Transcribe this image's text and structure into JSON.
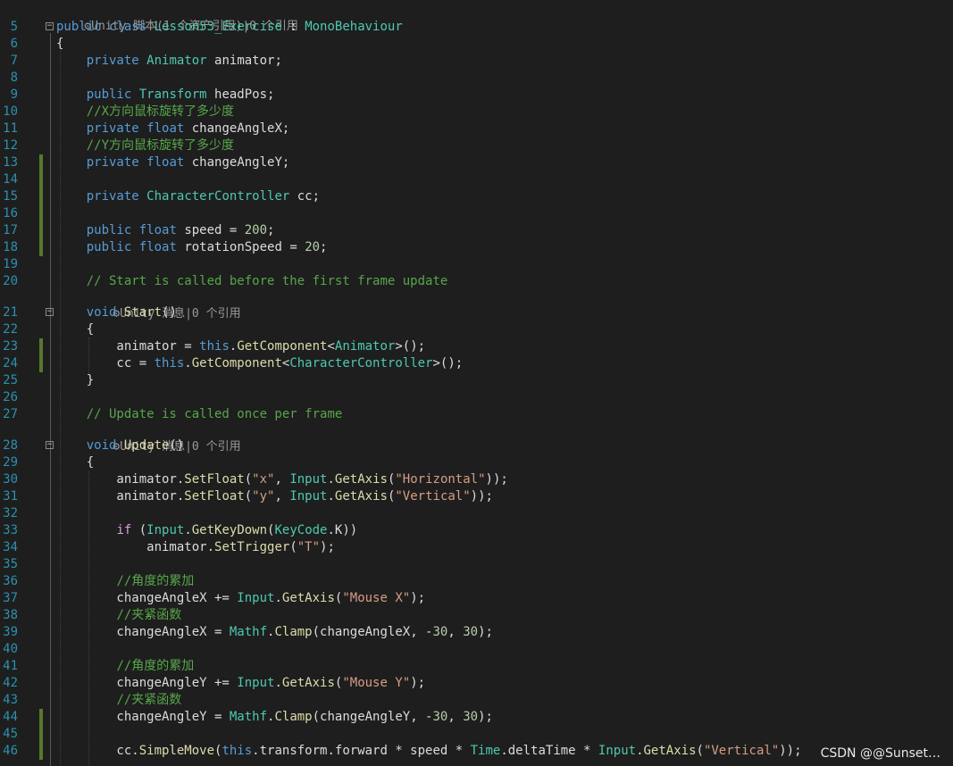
{
  "editor": {
    "codelens": {
      "class_refs": "Unity 脚本(1 个资产引用)|0 个引用",
      "start_refs": "Unity 消息|0 个引用",
      "update_refs": "Unity 消息|0 个引用"
    },
    "lines": [
      {
        "n": "5",
        "fold": "minus",
        "changed": false,
        "tokens": [
          {
            "t": "public",
            "c": "kw"
          },
          {
            "t": " "
          },
          {
            "t": "class",
            "c": "kw"
          },
          {
            "t": " "
          },
          {
            "t": "Lesson53_Exercise",
            "c": "ty"
          },
          {
            "t": " : "
          },
          {
            "t": "MonoBehaviour",
            "c": "ty"
          }
        ]
      },
      {
        "n": "6",
        "fold": "",
        "changed": false,
        "tokens": [
          {
            "t": "{"
          }
        ]
      },
      {
        "n": "7",
        "fold": "",
        "changed": false,
        "tokens": [
          {
            "t": "    "
          },
          {
            "t": "private",
            "c": "kw"
          },
          {
            "t": " "
          },
          {
            "t": "Animator",
            "c": "ty"
          },
          {
            "t": " animator;"
          }
        ]
      },
      {
        "n": "8",
        "fold": "",
        "changed": false,
        "tokens": []
      },
      {
        "n": "9",
        "fold": "",
        "changed": false,
        "tokens": [
          {
            "t": "    "
          },
          {
            "t": "public",
            "c": "kw"
          },
          {
            "t": " "
          },
          {
            "t": "Transform",
            "c": "ty"
          },
          {
            "t": " headPos;"
          }
        ]
      },
      {
        "n": "10",
        "fold": "",
        "changed": false,
        "tokens": [
          {
            "t": "    "
          },
          {
            "t": "//X方向鼠标旋转了多少度",
            "c": "cm"
          }
        ]
      },
      {
        "n": "11",
        "fold": "",
        "changed": false,
        "tokens": [
          {
            "t": "    "
          },
          {
            "t": "private",
            "c": "kw"
          },
          {
            "t": " "
          },
          {
            "t": "float",
            "c": "kw"
          },
          {
            "t": " changeAngleX;"
          }
        ]
      },
      {
        "n": "12",
        "fold": "",
        "changed": false,
        "tokens": [
          {
            "t": "    "
          },
          {
            "t": "//Y方向鼠标旋转了多少度",
            "c": "cm"
          }
        ]
      },
      {
        "n": "13",
        "fold": "",
        "changed": true,
        "tokens": [
          {
            "t": "    "
          },
          {
            "t": "private",
            "c": "kw"
          },
          {
            "t": " "
          },
          {
            "t": "float",
            "c": "kw"
          },
          {
            "t": " changeAngleY;"
          }
        ]
      },
      {
        "n": "14",
        "fold": "",
        "changed": true,
        "tokens": []
      },
      {
        "n": "15",
        "fold": "",
        "changed": true,
        "tokens": [
          {
            "t": "    "
          },
          {
            "t": "private",
            "c": "kw"
          },
          {
            "t": " "
          },
          {
            "t": "CharacterController",
            "c": "ty"
          },
          {
            "t": " cc;"
          }
        ]
      },
      {
        "n": "16",
        "fold": "",
        "changed": true,
        "tokens": []
      },
      {
        "n": "17",
        "fold": "",
        "changed": true,
        "tokens": [
          {
            "t": "    "
          },
          {
            "t": "public",
            "c": "kw"
          },
          {
            "t": " "
          },
          {
            "t": "float",
            "c": "kw"
          },
          {
            "t": " speed = "
          },
          {
            "t": "200",
            "c": "num"
          },
          {
            "t": ";"
          }
        ]
      },
      {
        "n": "18",
        "fold": "",
        "changed": true,
        "tokens": [
          {
            "t": "    "
          },
          {
            "t": "public",
            "c": "kw"
          },
          {
            "t": " "
          },
          {
            "t": "float",
            "c": "kw"
          },
          {
            "t": " rotationSpeed = "
          },
          {
            "t": "20",
            "c": "num"
          },
          {
            "t": ";"
          }
        ]
      },
      {
        "n": "19",
        "fold": "",
        "changed": false,
        "tokens": []
      },
      {
        "n": "20",
        "fold": "",
        "changed": false,
        "tokens": [
          {
            "t": "    "
          },
          {
            "t": "// Start is called before the first frame update",
            "c": "cm"
          }
        ]
      },
      {
        "n": "21",
        "fold": "minus",
        "changed": false,
        "tokens": [
          {
            "t": "    "
          },
          {
            "t": "void",
            "c": "kw"
          },
          {
            "t": " "
          },
          {
            "t": "Start",
            "c": "mth"
          },
          {
            "t": "()"
          }
        ]
      },
      {
        "n": "22",
        "fold": "",
        "changed": false,
        "tokens": [
          {
            "t": "    {"
          }
        ]
      },
      {
        "n": "23",
        "fold": "",
        "changed": true,
        "tokens": [
          {
            "t": "        animator = "
          },
          {
            "t": "this",
            "c": "kw"
          },
          {
            "t": "."
          },
          {
            "t": "GetComponent",
            "c": "mth"
          },
          {
            "t": "<"
          },
          {
            "t": "Animator",
            "c": "ty"
          },
          {
            "t": ">();"
          }
        ]
      },
      {
        "n": "24",
        "fold": "",
        "changed": true,
        "tokens": [
          {
            "t": "        cc = "
          },
          {
            "t": "this",
            "c": "kw"
          },
          {
            "t": "."
          },
          {
            "t": "GetComponent",
            "c": "mth"
          },
          {
            "t": "<"
          },
          {
            "t": "CharacterController",
            "c": "ty"
          },
          {
            "t": ">();"
          }
        ]
      },
      {
        "n": "25",
        "fold": "",
        "changed": false,
        "tokens": [
          {
            "t": "    }"
          }
        ]
      },
      {
        "n": "26",
        "fold": "",
        "changed": false,
        "tokens": []
      },
      {
        "n": "27",
        "fold": "",
        "changed": false,
        "tokens": [
          {
            "t": "    "
          },
          {
            "t": "// Update is called once per frame",
            "c": "cm"
          }
        ]
      },
      {
        "n": "28",
        "fold": "minus",
        "changed": false,
        "tokens": [
          {
            "t": "    "
          },
          {
            "t": "void",
            "c": "kw"
          },
          {
            "t": " "
          },
          {
            "t": "Update",
            "c": "mth"
          },
          {
            "t": "()"
          }
        ]
      },
      {
        "n": "29",
        "fold": "",
        "changed": false,
        "tokens": [
          {
            "t": "    {"
          }
        ]
      },
      {
        "n": "30",
        "fold": "",
        "changed": false,
        "tokens": [
          {
            "t": "        animator."
          },
          {
            "t": "SetFloat",
            "c": "mth"
          },
          {
            "t": "("
          },
          {
            "t": "\"x\"",
            "c": "str"
          },
          {
            "t": ", "
          },
          {
            "t": "Input",
            "c": "ty"
          },
          {
            "t": "."
          },
          {
            "t": "GetAxis",
            "c": "mth"
          },
          {
            "t": "("
          },
          {
            "t": "\"Horizontal\"",
            "c": "str"
          },
          {
            "t": "));"
          }
        ]
      },
      {
        "n": "31",
        "fold": "",
        "changed": false,
        "tokens": [
          {
            "t": "        animator."
          },
          {
            "t": "SetFloat",
            "c": "mth"
          },
          {
            "t": "("
          },
          {
            "t": "\"y\"",
            "c": "str"
          },
          {
            "t": ", "
          },
          {
            "t": "Input",
            "c": "ty"
          },
          {
            "t": "."
          },
          {
            "t": "GetAxis",
            "c": "mth"
          },
          {
            "t": "("
          },
          {
            "t": "\"Vertical\"",
            "c": "str"
          },
          {
            "t": "));"
          }
        ]
      },
      {
        "n": "32",
        "fold": "",
        "changed": false,
        "tokens": []
      },
      {
        "n": "33",
        "fold": "",
        "changed": false,
        "tokens": [
          {
            "t": "        "
          },
          {
            "t": "if",
            "c": "ctl"
          },
          {
            "t": " ("
          },
          {
            "t": "Input",
            "c": "ty"
          },
          {
            "t": "."
          },
          {
            "t": "GetKeyDown",
            "c": "mth"
          },
          {
            "t": "("
          },
          {
            "t": "KeyCode",
            "c": "ty"
          },
          {
            "t": ".K))"
          }
        ]
      },
      {
        "n": "34",
        "fold": "",
        "changed": false,
        "tokens": [
          {
            "t": "            animator."
          },
          {
            "t": "SetTrigger",
            "c": "mth"
          },
          {
            "t": "("
          },
          {
            "t": "\"T\"",
            "c": "str"
          },
          {
            "t": ");"
          }
        ]
      },
      {
        "n": "35",
        "fold": "",
        "changed": false,
        "tokens": []
      },
      {
        "n": "36",
        "fold": "",
        "changed": false,
        "tokens": [
          {
            "t": "        "
          },
          {
            "t": "//角度的累加",
            "c": "cm"
          }
        ]
      },
      {
        "n": "37",
        "fold": "",
        "changed": false,
        "tokens": [
          {
            "t": "        changeAngleX += "
          },
          {
            "t": "Input",
            "c": "ty"
          },
          {
            "t": "."
          },
          {
            "t": "GetAxis",
            "c": "mth"
          },
          {
            "t": "("
          },
          {
            "t": "\"Mouse X\"",
            "c": "str"
          },
          {
            "t": ");"
          }
        ]
      },
      {
        "n": "38",
        "fold": "",
        "changed": false,
        "tokens": [
          {
            "t": "        "
          },
          {
            "t": "//夹紧函数",
            "c": "cm"
          }
        ]
      },
      {
        "n": "39",
        "fold": "",
        "changed": false,
        "tokens": [
          {
            "t": "        changeAngleX = "
          },
          {
            "t": "Mathf",
            "c": "ty"
          },
          {
            "t": "."
          },
          {
            "t": "Clamp",
            "c": "mth"
          },
          {
            "t": "(changeAngleX, -"
          },
          {
            "t": "30",
            "c": "num"
          },
          {
            "t": ", "
          },
          {
            "t": "30",
            "c": "num"
          },
          {
            "t": ");"
          }
        ]
      },
      {
        "n": "40",
        "fold": "",
        "changed": false,
        "tokens": []
      },
      {
        "n": "41",
        "fold": "",
        "changed": false,
        "tokens": [
          {
            "t": "        "
          },
          {
            "t": "//角度的累加",
            "c": "cm"
          }
        ]
      },
      {
        "n": "42",
        "fold": "",
        "changed": false,
        "tokens": [
          {
            "t": "        changeAngleY += "
          },
          {
            "t": "Input",
            "c": "ty"
          },
          {
            "t": "."
          },
          {
            "t": "GetAxis",
            "c": "mth"
          },
          {
            "t": "("
          },
          {
            "t": "\"Mouse Y\"",
            "c": "str"
          },
          {
            "t": ");"
          }
        ]
      },
      {
        "n": "43",
        "fold": "",
        "changed": false,
        "tokens": [
          {
            "t": "        "
          },
          {
            "t": "//夹紧函数",
            "c": "cm"
          }
        ]
      },
      {
        "n": "44",
        "fold": "",
        "changed": true,
        "tokens": [
          {
            "t": "        changeAngleY = "
          },
          {
            "t": "Mathf",
            "c": "ty"
          },
          {
            "t": "."
          },
          {
            "t": "Clamp",
            "c": "mth"
          },
          {
            "t": "(changeAngleY, -"
          },
          {
            "t": "30",
            "c": "num"
          },
          {
            "t": ", "
          },
          {
            "t": "30",
            "c": "num"
          },
          {
            "t": ");"
          }
        ]
      },
      {
        "n": "45",
        "fold": "",
        "changed": true,
        "tokens": []
      },
      {
        "n": "46",
        "fold": "",
        "changed": true,
        "tokens": [
          {
            "t": "        cc."
          },
          {
            "t": "SimpleMove",
            "c": "mth"
          },
          {
            "t": "("
          },
          {
            "t": "this",
            "c": "kw"
          },
          {
            "t": ".transform.forward * speed * "
          },
          {
            "t": "Time",
            "c": "ty"
          },
          {
            "t": ".deltaTime * "
          },
          {
            "t": "Input",
            "c": "ty"
          },
          {
            "t": "."
          },
          {
            "t": "GetAxis",
            "c": "mth"
          },
          {
            "t": "("
          },
          {
            "t": "\"Vertical\"",
            "c": "str"
          },
          {
            "t": "));"
          }
        ]
      }
    ]
  },
  "watermark": "CSDN @@Sunset…"
}
